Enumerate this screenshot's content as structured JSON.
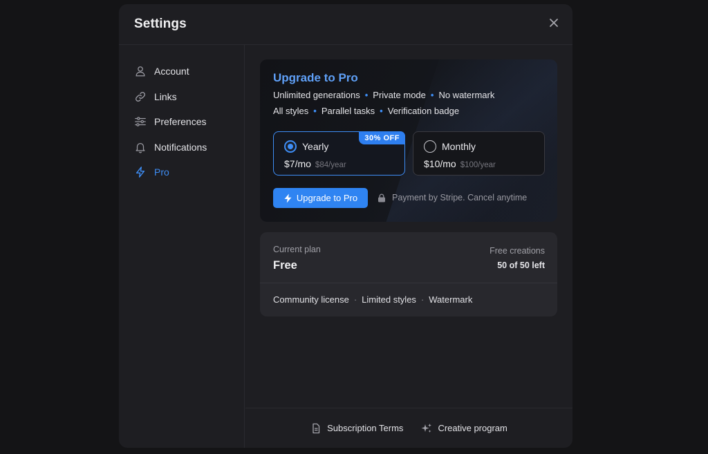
{
  "modal": {
    "title": "Settings"
  },
  "sidebar": {
    "items": [
      {
        "label": "Account",
        "icon": "user-icon"
      },
      {
        "label": "Links",
        "icon": "link-icon"
      },
      {
        "label": "Preferences",
        "icon": "sliders-icon"
      },
      {
        "label": "Notifications",
        "icon": "bell-icon"
      },
      {
        "label": "Pro",
        "icon": "lightning-icon",
        "active": true
      }
    ]
  },
  "pro": {
    "title": "Upgrade to Pro",
    "features_line1": [
      "Unlimited generations",
      "Private mode",
      "No watermark"
    ],
    "features_line2": [
      "All styles",
      "Parallel tasks",
      "Verification badge"
    ],
    "plans": {
      "yearly": {
        "name": "Yearly",
        "price": "$7/mo",
        "sub": "$84/year",
        "badge": "30% OFF",
        "selected": true
      },
      "monthly": {
        "name": "Monthly",
        "price": "$10/mo",
        "sub": "$100/year",
        "selected": false
      }
    },
    "upgrade_button": "Upgrade to Pro",
    "payment_note": "Payment by Stripe. Cancel anytime"
  },
  "current_plan": {
    "label": "Current plan",
    "value": "Free",
    "free_creations_label": "Free creations",
    "free_creations_value": "50 of 50 left",
    "features": [
      "Community license",
      "Limited styles",
      "Watermark"
    ]
  },
  "footer": {
    "terms": "Subscription Terms",
    "creative": "Creative program"
  },
  "colors": {
    "accent": "#3e8ef6",
    "background": "#141416",
    "modal": "#1e1e22"
  }
}
